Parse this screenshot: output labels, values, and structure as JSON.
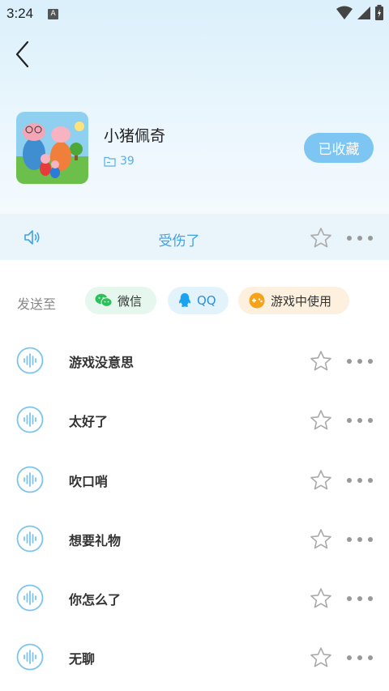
{
  "status_bar": {
    "time": "3:24",
    "notification_letter": "A"
  },
  "album": {
    "title": "小猪佩奇",
    "count": "39",
    "favorite_label": "已收藏"
  },
  "now_playing": {
    "title": "受伤了"
  },
  "share": {
    "label": "发送至",
    "targets": [
      {
        "label": "微信",
        "icon": "wechat-icon"
      },
      {
        "label": "QQ",
        "icon": "qq-icon"
      },
      {
        "label": "游戏中使用",
        "icon": "gamepad-icon"
      }
    ]
  },
  "sounds": [
    {
      "name": "游戏没意思"
    },
    {
      "name": "太好了"
    },
    {
      "name": "吹口哨"
    },
    {
      "name": "想要礼物"
    },
    {
      "name": "你怎么了"
    },
    {
      "name": "无聊"
    }
  ],
  "colors": {
    "accent": "#3fa2e8",
    "favorite_button": "#7dc6f3",
    "header_bg": "#dbf0fb",
    "now_playing_bg": "#e9f4fb"
  }
}
